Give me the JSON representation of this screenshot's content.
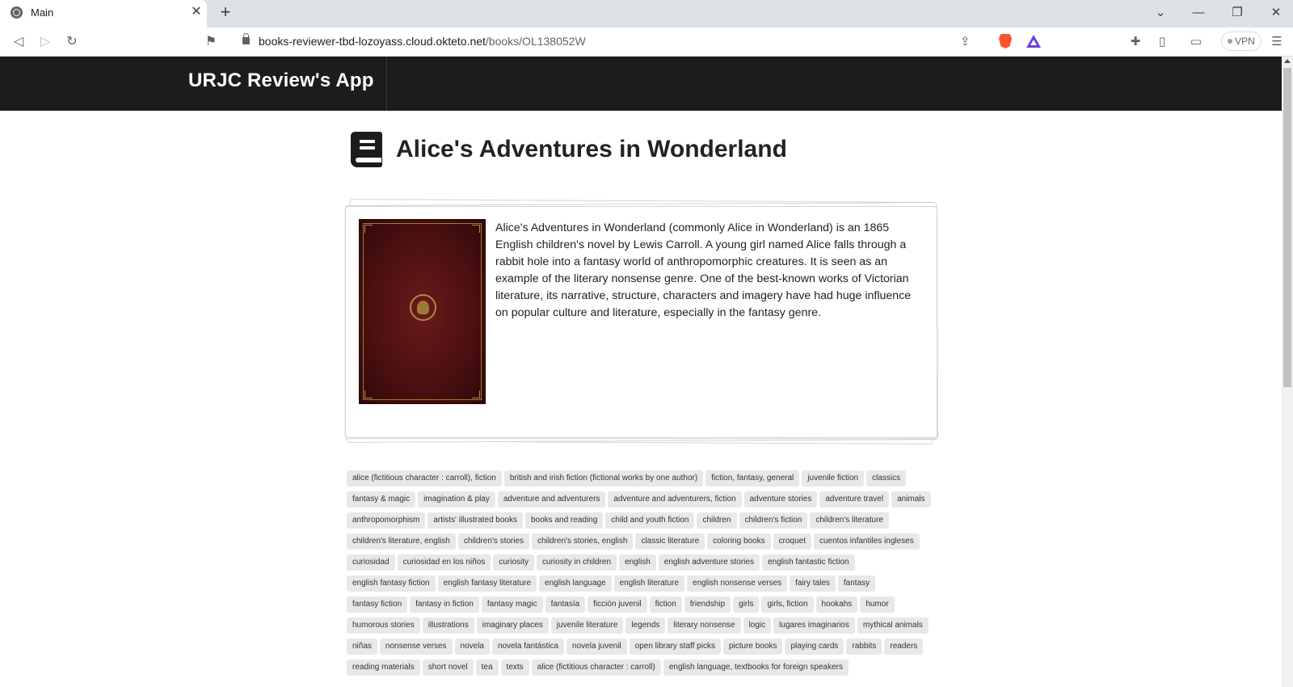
{
  "browser": {
    "tab_title": "Main",
    "tab_close": "✕",
    "new_tab": "+",
    "url_host": "books-reviewer-tbd-lozoyass.cloud.okteto.net",
    "url_path": "/books/OL138052W",
    "vpn_label": "VPN"
  },
  "app": {
    "brand": "URJC Review's App"
  },
  "book": {
    "title": "Alice's Adventures in Wonderland",
    "description": "Alice's Adventures in Wonderland (commonly Alice in Wonderland) is an 1865 English children's novel by Lewis Carroll. A young girl named Alice falls through a rabbit hole into a fantasy world of anthropomorphic creatures. It is seen as an example of the literary nonsense genre. One of the best-known works of Victorian literature, its narrative, structure, characters and imagery have had huge influence on popular culture and literature, especially in the fantasy genre."
  },
  "tags": [
    "alice (fictitious character : carroll), fiction",
    "british and irish fiction (fictional works by one author)",
    "fiction, fantasy, general",
    "juvenile fiction",
    "classics",
    "fantasy & magic",
    "imagination & play",
    "adventure and adventurers",
    "adventure and adventurers, fiction",
    "adventure stories",
    "adventure travel",
    "animals",
    "anthropomorphism",
    "artists' illustrated books",
    "books and reading",
    "child and youth fiction",
    "children",
    "children's fiction",
    "children's literature",
    "children's literature, english",
    "children's stories",
    "children's stories, english",
    "classic literature",
    "coloring books",
    "croquet",
    "cuentos infantiles ingleses",
    "curiosidad",
    "curiosidad en los niños",
    "curiosity",
    "curiosity in children",
    "english",
    "english adventure stories",
    "english fantastic fiction",
    "english fantasy fiction",
    "english fantasy literature",
    "english language",
    "english literature",
    "english nonsense verses",
    "fairy tales",
    "fantasy",
    "fantasy fiction",
    "fantasy in fiction",
    "fantasy magic",
    "fantasía",
    "ficción juvenil",
    "fiction",
    "friendship",
    "girls",
    "girls, fiction",
    "hookahs",
    "humor",
    "humorous stories",
    "illustrations",
    "imaginary places",
    "juvenile literature",
    "legends",
    "literary nonsense",
    "logic",
    "lugares imaginarios",
    "mythical animals",
    "niñas",
    "nonsense verses",
    "novela",
    "novela fantástica",
    "novela juvenil",
    "open library staff picks",
    "picture books",
    "playing cards",
    "rabbits",
    "readers",
    "reading materials",
    "short novel",
    "tea",
    "texts",
    "alice (fictitious character : carroll)",
    "english language, textbooks for foreign speakers"
  ],
  "colors": {
    "header_bg": "#1b1c1d",
    "tag_bg": "#e8e8e8",
    "cover": "#4a0f10"
  }
}
